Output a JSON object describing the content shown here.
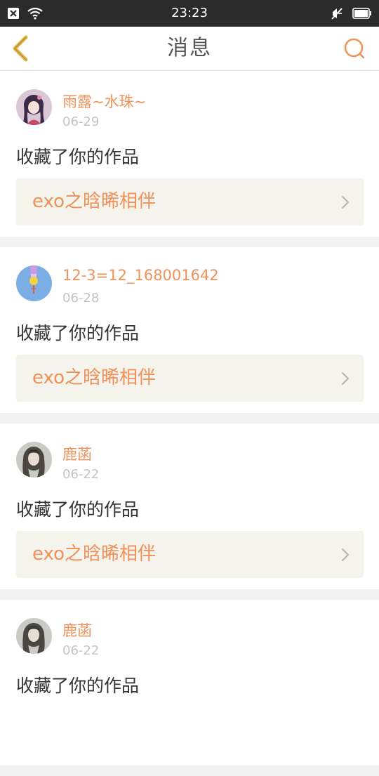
{
  "status_bar": {
    "time": "23:23",
    "icons": [
      "notification-close-icon",
      "wifi-icon",
      "mute-icon",
      "battery-icon"
    ]
  },
  "nav": {
    "title": "消息",
    "back_icon": "chevron-left-icon",
    "search_icon": "search-icon"
  },
  "colors": {
    "accent": "#f0915a",
    "back_icon": "#e3b23c",
    "status_bar_bg": "#2b2b2b",
    "link_bg": "#f4f3ec"
  },
  "messages": [
    {
      "username": "雨露~水珠~",
      "date": "06-29",
      "action": "收藏了你的作品",
      "work_title": "exo之晗晞相伴",
      "avatar": "anime-girl-avatar"
    },
    {
      "username": "12-3=12_168001642",
      "date": "06-28",
      "action": "收藏了你的作品",
      "work_title": "exo之晗晞相伴",
      "avatar": "blue-lollipop-avatar"
    },
    {
      "username": "鹿菡",
      "date": "06-22",
      "action": "收藏了你的作品",
      "work_title": "exo之晗晞相伴",
      "avatar": "girl-photo-avatar"
    },
    {
      "username": "鹿菡",
      "date": "06-22",
      "action": "收藏了你的作品",
      "work_title": "",
      "avatar": "girl-photo-avatar"
    }
  ]
}
